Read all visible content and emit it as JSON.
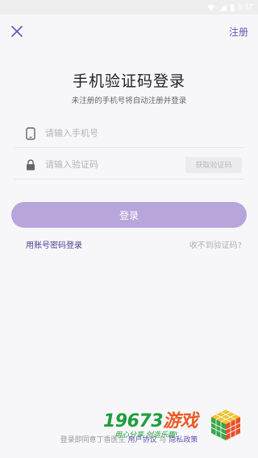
{
  "status_bar": {
    "time": "9:37"
  },
  "header": {
    "register_label": "注册"
  },
  "main": {
    "title": "手机验证码登录",
    "subtitle": "未注册的手机号将自动注册并登录",
    "phone_placeholder": "请输入手机号",
    "code_placeholder": "请输入验证码",
    "get_code_label": "获取验证码",
    "login_label": "登录",
    "password_login_label": "用账号密码登录",
    "no_code_label": "收不到验证码?"
  },
  "footer": {
    "agree_text": "登录即同意丁香医生",
    "user_agreement": "用户协议",
    "and_text": "与",
    "privacy_policy": "隐私政策"
  },
  "watermark": {
    "brand_number": "19673",
    "brand_word": "游戏",
    "slogan": "用心分享 创造乐趣!"
  },
  "colors": {
    "accent": "#6a52b5",
    "login_button": "#b8a5dc",
    "background": "#f7f7f9"
  },
  "icons": {
    "close": "close-icon",
    "phone": "phone-icon",
    "lock": "lock-icon"
  }
}
